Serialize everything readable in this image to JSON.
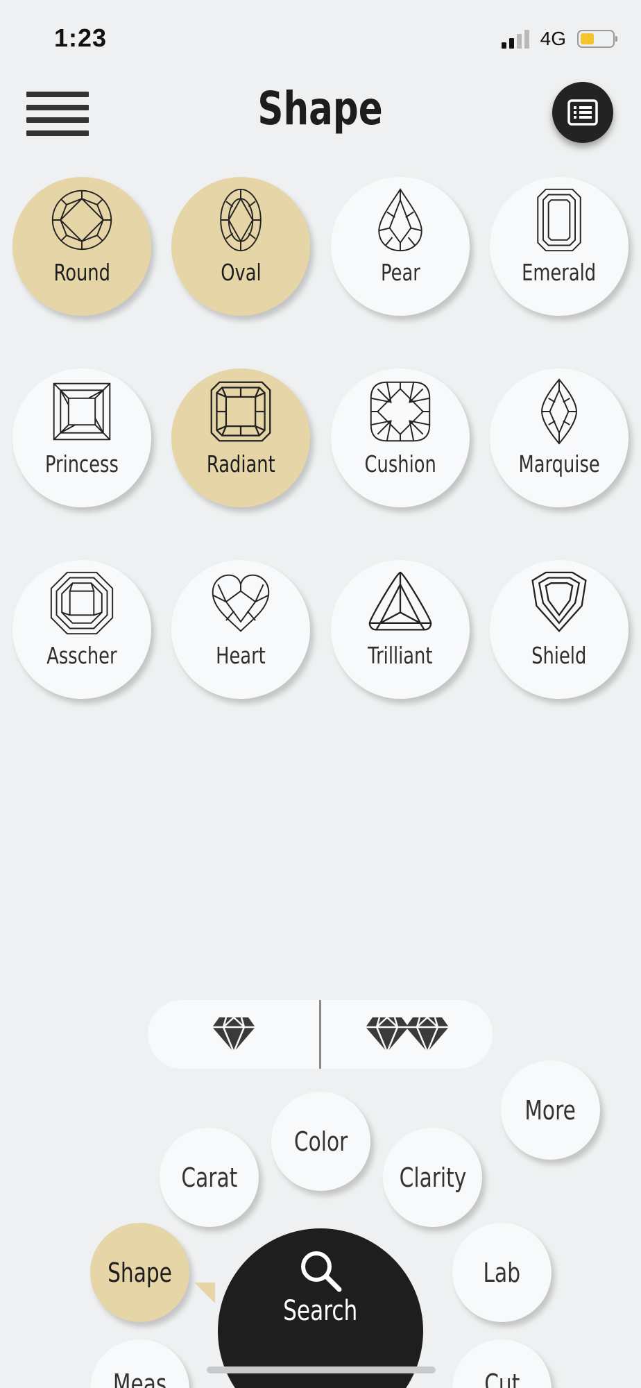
{
  "status_bar": {
    "time": "1:23",
    "network": "4G",
    "battery_color": "#f4c430"
  },
  "header": {
    "title": "Shape",
    "menu_icon": "hamburger-icon",
    "list_icon": "list-icon"
  },
  "shapes": [
    {
      "label": "Round",
      "selected": true
    },
    {
      "label": "Oval",
      "selected": true
    },
    {
      "label": "Pear",
      "selected": false
    },
    {
      "label": "Emerald",
      "selected": false
    },
    {
      "label": "Princess",
      "selected": false
    },
    {
      "label": "Radiant",
      "selected": true
    },
    {
      "label": "Cushion",
      "selected": false
    },
    {
      "label": "Marquise",
      "selected": false
    },
    {
      "label": "Asscher",
      "selected": false
    },
    {
      "label": "Heart",
      "selected": false
    },
    {
      "label": "Trilliant",
      "selected": false
    },
    {
      "label": "Shield",
      "selected": false
    }
  ],
  "view_toggle": {
    "single_icon": "single-diamond-icon",
    "pair_icon": "pair-diamond-icon"
  },
  "bottom_nav": {
    "color": "Color",
    "more": "More",
    "carat": "Carat",
    "clarity": "Clarity",
    "shape": "Shape",
    "lab": "Lab",
    "meas": "Meas",
    "cut": "Cut",
    "search": "Search"
  },
  "colors": {
    "selected": "#e6d5a7",
    "background": "#eef0f1",
    "dark": "#1e1e1f"
  }
}
